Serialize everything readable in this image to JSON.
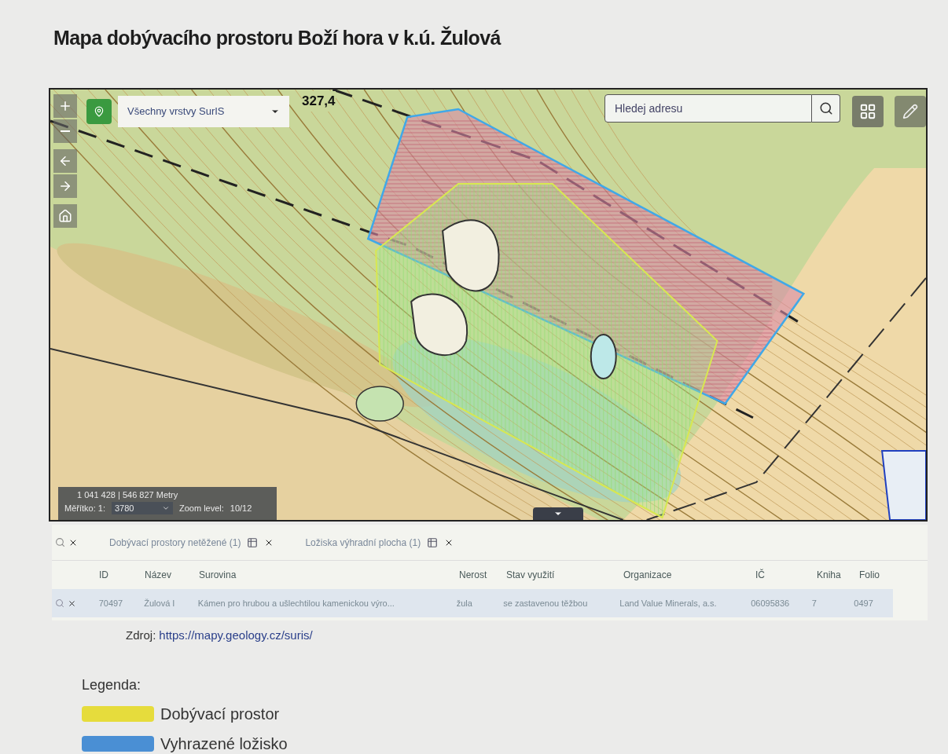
{
  "title": "Mapa dobývacího prostoru Boží hora v k.ú. Žulová",
  "map": {
    "layer_select": {
      "value": "Všechny vrstvy SurIS"
    },
    "search": {
      "placeholder": "Hledej adresu"
    },
    "label": "327,4",
    "coordinates": "1 041 428 | 546 827 Metry",
    "scale_label": "Měřítko: 1:",
    "scale_value": "3780",
    "zoom_label": "Zoom level:",
    "zoom_value": "10/12"
  },
  "tabs": [
    {
      "label": "Dobývací prostory netěžené (1)"
    },
    {
      "label": "Ložiska výhradní plocha (1)"
    }
  ],
  "table": {
    "columns": [
      "ID",
      "Název",
      "Surovina",
      "Nerost",
      "Stav využití",
      "Organizace",
      "IČ",
      "Kniha",
      "Folio"
    ],
    "rows": [
      {
        "selected": true,
        "cells": [
          "70497",
          "Žulová I",
          "Kámen pro hrubou a ušlechtilou kamenickou výro...",
          "žula",
          "se zastavenou těžbou",
          "Land Value Minerals, a.s.",
          "06095836",
          "7",
          "0497"
        ]
      }
    ]
  },
  "source": {
    "label": "Zdroj:",
    "link": "https://mapy.geology.cz/suris/"
  },
  "legend": {
    "title": "Legenda:",
    "items": [
      {
        "label": "Dobývací prostor",
        "color": "#e6dc3c"
      },
      {
        "label": "Vyhrazené ložisko",
        "color": "#4a8fd4"
      }
    ]
  }
}
